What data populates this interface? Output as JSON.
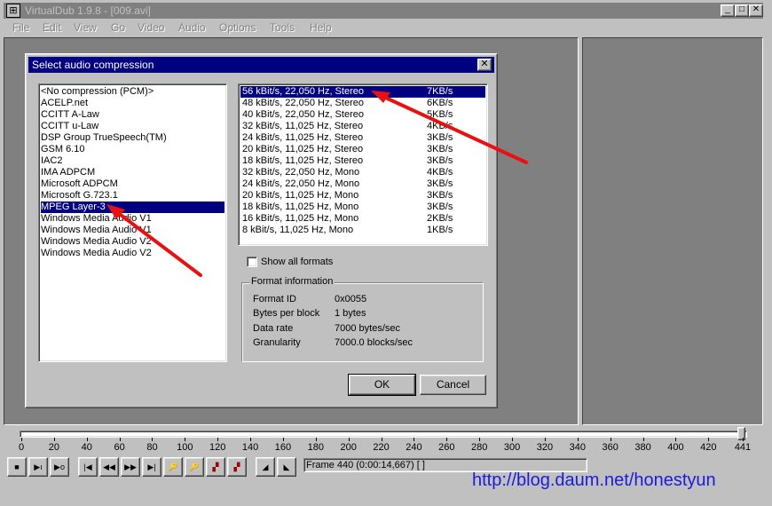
{
  "window": {
    "title": "VirtualDub 1.9.8 - [009.avi]",
    "min": "_",
    "max": "□",
    "close": "✕"
  },
  "menu": [
    "File",
    "Edit",
    "View",
    "Go",
    "Video",
    "Audio",
    "Options",
    "Tools",
    "Help"
  ],
  "dialog": {
    "title": "Select audio compression",
    "close": "✕",
    "codecs": [
      "<No compression (PCM)>",
      "ACELP.net",
      "CCITT A-Law",
      "CCITT u-Law",
      "DSP Group TrueSpeech(TM)",
      "GSM 6.10",
      "IAC2",
      "IMA ADPCM",
      "Microsoft ADPCM",
      "Microsoft G.723.1",
      "MPEG Layer-3",
      "Windows Media Audio V1",
      "Windows Media Audio V1",
      "Windows Media Audio V2",
      "Windows Media Audio V2"
    ],
    "selected_codec_index": 10,
    "formats": [
      {
        "name": "56 kBit/s, 22,050 Hz, Stereo",
        "rate": "7KB/s"
      },
      {
        "name": "48 kBit/s, 22,050 Hz, Stereo",
        "rate": "6KB/s"
      },
      {
        "name": "40 kBit/s, 22,050 Hz, Stereo",
        "rate": "5KB/s"
      },
      {
        "name": "32 kBit/s, 11,025 Hz, Stereo",
        "rate": "4KB/s"
      },
      {
        "name": "24 kBit/s, 11,025 Hz, Stereo",
        "rate": "3KB/s"
      },
      {
        "name": "20 kBit/s, 11,025 Hz, Stereo",
        "rate": "3KB/s"
      },
      {
        "name": "18 kBit/s, 11,025 Hz, Stereo",
        "rate": "3KB/s"
      },
      {
        "name": "32 kBit/s, 22,050 Hz, Mono",
        "rate": "4KB/s"
      },
      {
        "name": "24 kBit/s, 22,050 Hz, Mono",
        "rate": "3KB/s"
      },
      {
        "name": "20 kBit/s, 11,025 Hz, Mono",
        "rate": "3KB/s"
      },
      {
        "name": "18 kBit/s, 11,025 Hz, Mono",
        "rate": "3KB/s"
      },
      {
        "name": "16 kBit/s, 11,025 Hz, Mono",
        "rate": "2KB/s"
      },
      {
        "name": "8 kBit/s, 11,025 Hz, Mono",
        "rate": "1KB/s"
      }
    ],
    "selected_format_index": 0,
    "show_all_formats_label": "Show all formats",
    "show_all_formats_checked": false,
    "format_info": {
      "title": "Format information",
      "rows": [
        {
          "key": "Format ID",
          "value": "0x0055"
        },
        {
          "key": "Bytes per block",
          "value": "1 bytes"
        },
        {
          "key": "Data rate",
          "value": "7000 bytes/sec"
        },
        {
          "key": "Granularity",
          "value": "7000.0 blocks/sec"
        }
      ]
    },
    "ok_label": "OK",
    "cancel_label": "Cancel"
  },
  "timeline": {
    "ticks": [
      "0",
      "20",
      "40",
      "60",
      "80",
      "100",
      "120",
      "140",
      "160",
      "180",
      "200",
      "220",
      "240",
      "260",
      "280",
      "300",
      "320",
      "340",
      "360",
      "380",
      "400",
      "420",
      "441"
    ],
    "max_frame": 441,
    "current_frame": 440
  },
  "status": {
    "frame_text": "Frame 440 (0:00:14,667) [ ]"
  },
  "transport_icons": [
    "stop-icon",
    "play-input-icon",
    "play-output-icon",
    "go-start-icon",
    "prev-frame-icon",
    "next-frame-icon",
    "go-end-icon",
    "prev-key-icon",
    "next-key-icon",
    "prev-scene-icon",
    "next-scene-icon",
    "mark-in-icon",
    "mark-out-icon"
  ],
  "watermark": "http://blog.daum.net/honestyun",
  "colors": {
    "title_active": "#000080",
    "title_inactive": "#808080",
    "annotation_arrow": "#e81010",
    "watermark": "#1b1bdf"
  }
}
